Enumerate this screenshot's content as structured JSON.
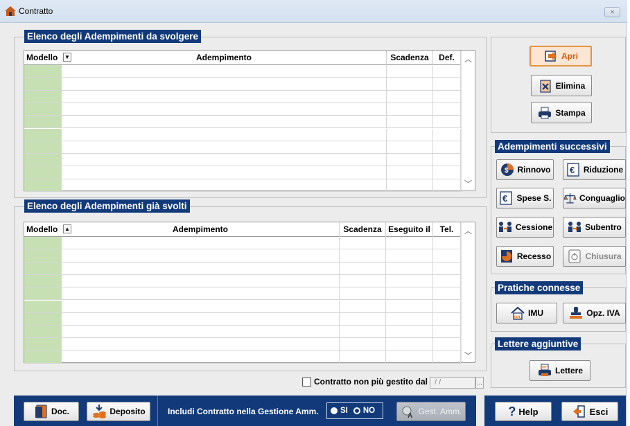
{
  "window": {
    "title": "Contratto",
    "close_label": "⨯"
  },
  "pending": {
    "title": "Elenco degli Adempimenti da svolgere",
    "columns": {
      "modello": "Modello",
      "adempimento": "Adempimento",
      "scadenza": "Scadenza",
      "def": "Def."
    }
  },
  "done": {
    "title": "Elenco degli Adempimenti già svolti",
    "columns": {
      "modello": "Modello",
      "adempimento": "Adempimento",
      "scadenza": "Scadenza",
      "eseguito": "Eseguito il",
      "tel": "Tel."
    }
  },
  "actions": {
    "apri": "Apri",
    "elimina": "Elimina",
    "stampa": "Stampa"
  },
  "successivi": {
    "title": "Adempimenti successivi",
    "rinnovo": "Rinnovo",
    "riduzione": "Riduzione",
    "spese": "Spese S.",
    "conguaglio": "Conguaglio",
    "cessione": "Cessione",
    "subentro": "Subentro",
    "recesso": "Recesso",
    "chiusura": "Chiusura"
  },
  "pratiche": {
    "title": "Pratiche connesse",
    "imu": "IMU",
    "opz_iva": "Opz. IVA"
  },
  "lettere": {
    "title": "Lettere aggiuntive",
    "lettere_btn": "Lettere"
  },
  "footer": {
    "chk_label": "Contratto non più gestito dal",
    "date_value": "/ /",
    "doc": "Doc.",
    "deposito": "Deposito",
    "includi": "Includi Contratto nella Gestione Amm.",
    "si": "SI",
    "no": "NO",
    "gest": "Gest. Amm.",
    "help": "Help",
    "esci": "Esci"
  },
  "colors": {
    "header_blue": "#123a7b",
    "model_green": "#c6e0b4",
    "accent_orange": "#e7913f"
  }
}
